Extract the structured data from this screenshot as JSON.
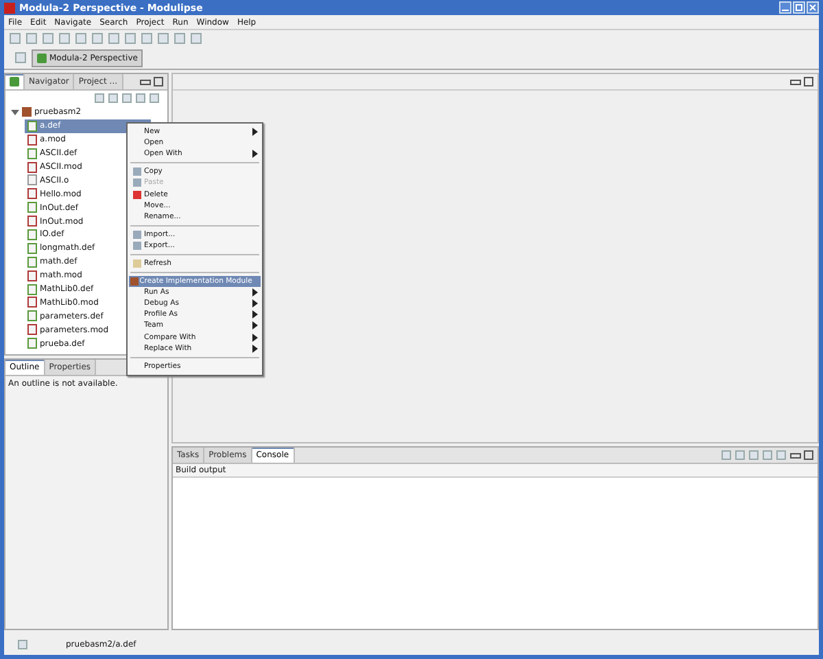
{
  "window": {
    "title": "Modula-2 Perspective - Modulipse"
  },
  "menu_bar": [
    "File",
    "Edit",
    "Navigate",
    "Search",
    "Project",
    "Run",
    "Window",
    "Help"
  ],
  "perspective": {
    "label": "Modula-2 Perspective",
    "selected": true
  },
  "explorer_tabs": [
    {
      "selected": true
    },
    {
      "label": "Navigator",
      "selected": false
    },
    {
      "label": "Project ...",
      "selected": false
    }
  ],
  "tree": {
    "label": "pruebasm2",
    "expanded": true,
    "children": [
      {
        "label": "a.def",
        "kind": "def",
        "selected": true
      },
      {
        "label": "a.mod",
        "kind": "mod",
        "selected": false
      },
      {
        "label": "ASCII.def",
        "kind": "def",
        "selected": false
      },
      {
        "label": "ASCII.mod",
        "kind": "mod",
        "selected": false
      },
      {
        "label": "ASCII.o",
        "kind": "other",
        "selected": false
      },
      {
        "label": "Hello.mod",
        "kind": "mod",
        "selected": false
      },
      {
        "label": "InOut.def",
        "kind": "def",
        "selected": false
      },
      {
        "label": "InOut.mod",
        "kind": "mod",
        "selected": false
      },
      {
        "label": "IO.def",
        "kind": "def",
        "selected": false
      },
      {
        "label": "longmath.def",
        "kind": "def",
        "selected": false
      },
      {
        "label": "math.def",
        "kind": "def",
        "selected": false
      },
      {
        "label": "math.mod",
        "kind": "mod",
        "selected": false
      },
      {
        "label": "MathLib0.def",
        "kind": "def",
        "selected": false
      },
      {
        "label": "MathLib0.mod",
        "kind": "mod",
        "selected": false
      },
      {
        "label": "parameters.def",
        "kind": "def",
        "selected": false
      },
      {
        "label": "parameters.mod",
        "kind": "mod",
        "selected": false
      },
      {
        "label": "prueba.def",
        "kind": "def",
        "selected": false
      }
    ]
  },
  "context_menu": [
    {
      "kind": "item",
      "label": "New",
      "submenu": true,
      "disabled": false,
      "selected": false
    },
    {
      "kind": "item",
      "label": "Open",
      "submenu": false,
      "disabled": false,
      "selected": false
    },
    {
      "kind": "item",
      "label": "Open With",
      "submenu": true,
      "disabled": false,
      "selected": false
    },
    {
      "kind": "separator"
    },
    {
      "kind": "item",
      "label": "Copy",
      "submenu": false,
      "disabled": false,
      "selected": false
    },
    {
      "kind": "item",
      "label": "Paste",
      "submenu": false,
      "disabled": true,
      "selected": false
    },
    {
      "kind": "item",
      "label": "Delete",
      "submenu": false,
      "disabled": false,
      "selected": false
    },
    {
      "kind": "item",
      "label": "Move...",
      "submenu": false,
      "disabled": false,
      "selected": false
    },
    {
      "kind": "item",
      "label": "Rename...",
      "submenu": false,
      "disabled": false,
      "selected": false
    },
    {
      "kind": "separator"
    },
    {
      "kind": "item",
      "label": "Import...",
      "submenu": false,
      "disabled": false,
      "selected": false
    },
    {
      "kind": "item",
      "label": "Export...",
      "submenu": false,
      "disabled": false,
      "selected": false
    },
    {
      "kind": "separator"
    },
    {
      "kind": "item",
      "label": "Refresh",
      "submenu": false,
      "disabled": false,
      "selected": false
    },
    {
      "kind": "separator"
    },
    {
      "kind": "item",
      "label": "Create Implementation Module",
      "submenu": false,
      "disabled": false,
      "selected": true
    },
    {
      "kind": "item",
      "label": "Run As",
      "submenu": true,
      "disabled": false,
      "selected": false
    },
    {
      "kind": "item",
      "label": "Debug As",
      "submenu": true,
      "disabled": false,
      "selected": false
    },
    {
      "kind": "item",
      "label": "Profile As",
      "submenu": true,
      "disabled": false,
      "selected": false
    },
    {
      "kind": "item",
      "label": "Team",
      "submenu": true,
      "disabled": false,
      "selected": false
    },
    {
      "kind": "item",
      "label": "Compare With",
      "submenu": true,
      "disabled": false,
      "selected": false
    },
    {
      "kind": "item",
      "label": "Replace With",
      "submenu": true,
      "disabled": false,
      "selected": false
    },
    {
      "kind": "separator"
    },
    {
      "kind": "item",
      "label": "Properties",
      "submenu": false,
      "disabled": false,
      "selected": false
    }
  ],
  "outline_tabs": [
    {
      "label": "Outline",
      "selected": true
    },
    {
      "label": "Properties",
      "selected": false
    }
  ],
  "outline_message": "An outline is not available.",
  "bottom_tabs": [
    {
      "label": "Tasks",
      "selected": false
    },
    {
      "label": "Problems",
      "selected": false
    },
    {
      "label": "Console",
      "selected": true
    }
  ],
  "console_title": "Build output",
  "status_bar": "pruebasm2/a.def"
}
